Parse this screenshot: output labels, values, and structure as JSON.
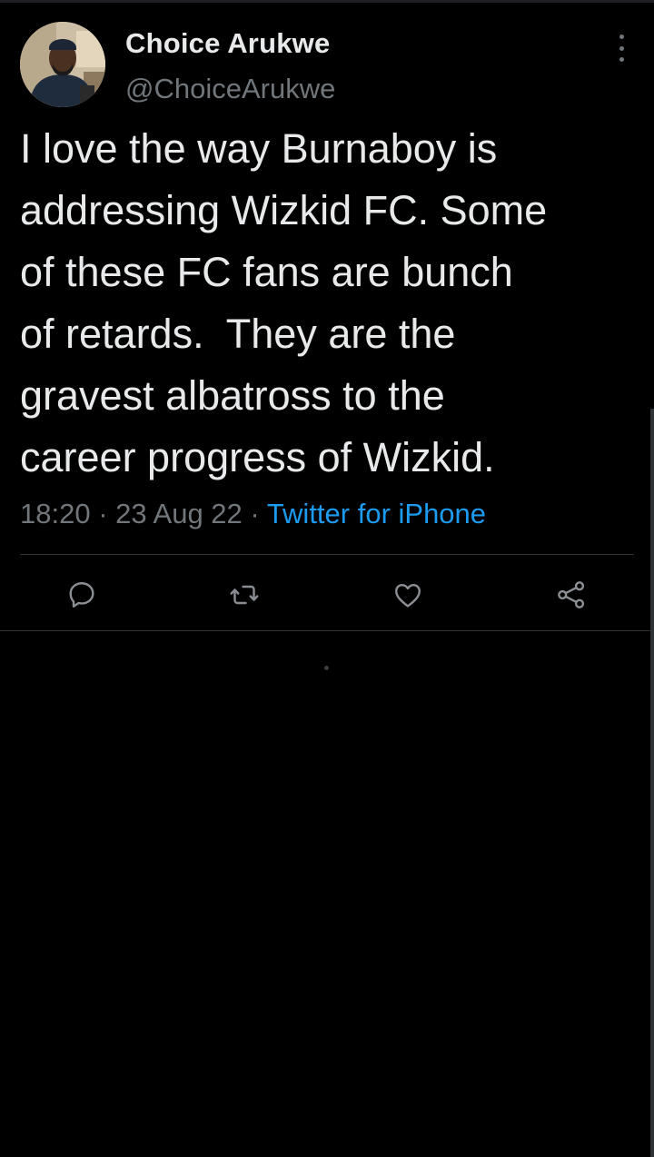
{
  "tweet": {
    "author_name": "Choice Arukwe",
    "author_handle": "@ChoiceArukwe",
    "text": "I love the way Burnaboy is\naddressing Wizkid FC. Some\nof these FC fans are bunch\nof retards.  They are the\ngravest albatross to the\ncareer progress of Wizkid.",
    "time": "18:20",
    "separator": "·",
    "date": "23 Aug 22",
    "source": "Twitter for iPhone"
  },
  "icons": {
    "more": "more-vertical-icon",
    "reply": "reply-icon",
    "retweet": "retweet-icon",
    "like": "heart-icon",
    "share": "share-icon"
  },
  "colors": {
    "background": "#000000",
    "text_primary": "#e7e9ea",
    "text_secondary": "#71767b",
    "accent": "#1d9bf0",
    "divider": "#2f3336"
  }
}
